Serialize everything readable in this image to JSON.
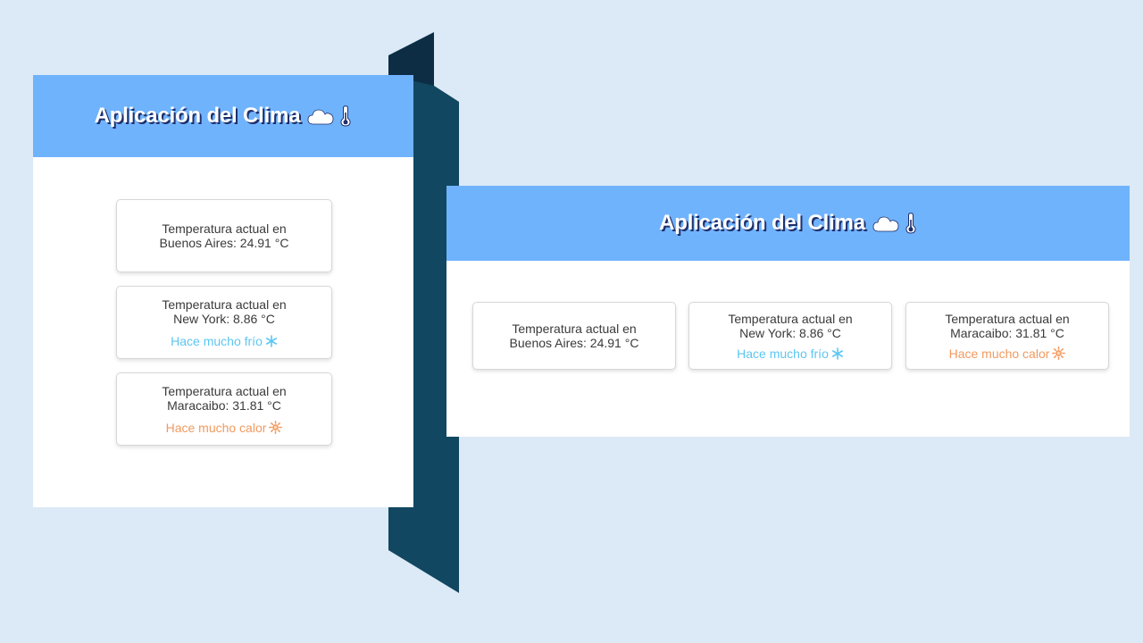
{
  "colors": {
    "background": "#dce9f6",
    "header": "#70b3fd",
    "title_shadow": "#1f2f6b",
    "cold_text": "#5cc6f2",
    "hot_text": "#f19a5f",
    "panel_dark": "#0c2d44",
    "panel_mid": "#114760"
  },
  "mobile_app": {
    "title": "Aplicación del Clima",
    "title_icons": [
      "cloud-icon",
      "thermometer-icon"
    ],
    "cards": [
      {
        "text": "Temperatura actual en Buenos Aires: 24.91 °C"
      },
      {
        "text": "Temperatura actual en New York: 8.86 °C",
        "note": "Hace mucho frío",
        "note_icon": "snowflake-icon"
      },
      {
        "text": "Temperatura actual en Maracaibo: 31.81 °C",
        "note": "Hace mucho calor",
        "note_icon": "sun-icon"
      }
    ]
  },
  "desktop_app": {
    "title": "Aplicación del Clima",
    "title_icons": [
      "cloud-icon",
      "thermometer-icon"
    ],
    "cards": [
      {
        "text": "Temperatura actual en Buenos Aires: 24.91 °C"
      },
      {
        "text": "Temperatura actual en New York: 8.86 °C",
        "note": "Hace mucho frío",
        "note_icon": "snowflake-icon"
      },
      {
        "text": "Temperatura actual en Maracaibo: 31.81 °C",
        "note": "Hace mucho calor",
        "note_icon": "sun-icon"
      }
    ]
  }
}
